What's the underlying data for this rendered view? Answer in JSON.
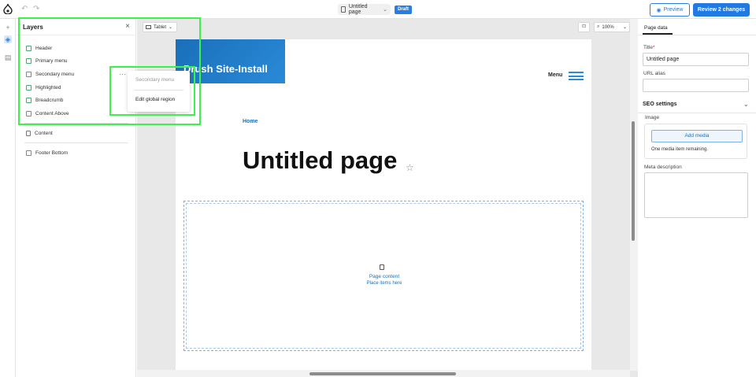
{
  "topbar": {
    "undo_icon": "undo-icon",
    "redo_icon": "redo-icon",
    "page_title": "Untitled page",
    "status_badge": "Draft",
    "preview_label": "Preview",
    "review_label": "Review 2 changes",
    "accent": "#1f7ae3"
  },
  "rail": {
    "items": [
      "add-icon",
      "layers-icon",
      "library-icon"
    ]
  },
  "layers": {
    "title": "Layers",
    "items": [
      {
        "label": "Header"
      },
      {
        "label": "Primary menu"
      },
      {
        "label": "Secondary menu"
      },
      {
        "label": "Highlighted"
      },
      {
        "label": "Breadcrumb"
      },
      {
        "label": "Content Above"
      },
      {
        "label": "Content"
      },
      {
        "label": "Footer Bottom"
      }
    ],
    "highlight_color": "#3ef04a"
  },
  "context_menu": {
    "header": "Secondary menu",
    "item": "Edit global region"
  },
  "canvas": {
    "device": "Tablet",
    "zoom": "100%",
    "site_name": "Drush Site-Install",
    "menu_label": "Menu",
    "breadcrumb": "Home",
    "page_heading": "Untitled page",
    "content_zone_title": "Page content",
    "content_zone_sub": "Place items here",
    "brand_color": "#1a6fb8"
  },
  "right_panel": {
    "tab": "Page data",
    "title_label": "Title",
    "title_value": "Untitled page",
    "url_label": "URL alias",
    "url_value": "",
    "seo_heading": "SEO settings",
    "image_label": "Image",
    "add_media_label": "Add media",
    "media_remaining": "One media item remaining.",
    "meta_label": "Meta description"
  }
}
